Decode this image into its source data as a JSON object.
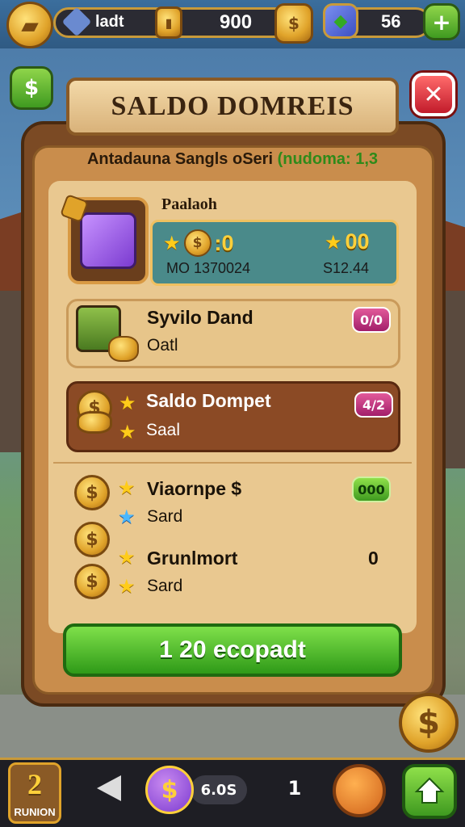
{
  "topbar": {
    "label": "ladt",
    "coins": "900",
    "gems": "56"
  },
  "dialog": {
    "title": "SALDO DOMREIS",
    "subtitle_main": "Antadauna Sangls oSeri",
    "subtitle_highlight": "(nudoma: 1,3",
    "close_symbol": "✕",
    "back_symbol": "$"
  },
  "top_card": {
    "label": "Paalaoh",
    "value_left": ":0",
    "value_right": "00",
    "sub_left": "MO 1370024",
    "sub_right": "S12.44"
  },
  "rows": [
    {
      "title": "Syvilo Dand",
      "sub": "Oatl",
      "badge": "0/0"
    },
    {
      "title": "Saldo Dompet",
      "sub": "Saal",
      "badge": "4/2"
    }
  ],
  "rewards": [
    {
      "title": "Viaornpe $",
      "sub": "Sard",
      "badge": "000"
    },
    {
      "title": "Grunlmort",
      "sub": "Sard",
      "value": "0"
    }
  ],
  "cta": {
    "label": "1 20 ecopadt"
  },
  "bottom_nav": {
    "level": "2",
    "level_label": "RUNION",
    "pill": "6.0S",
    "num": "1"
  },
  "icons": {
    "coin_symbol": "$"
  },
  "colors": {
    "accent_gold": "#e0a32a",
    "cta_green": "#3f9a20",
    "close_red": "#c21b2b",
    "badge_pink": "#a21e6a",
    "highlight_row": "#8b4a25"
  }
}
